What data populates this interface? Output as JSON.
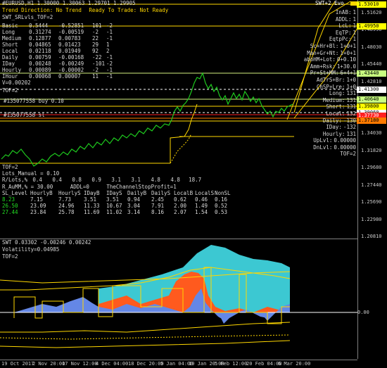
{
  "header": {
    "symbol_line": "#EURUSD,H1  1.30000 1.30063 1.29701 1.29905",
    "swt_top_right": "SWT+2 Evo",
    "trend_direction_label": "Trend Direction:",
    "trend_direction_value": "No Trend",
    "ready_label": "Ready To Trade:",
    "ready_value": "Not Ready",
    "indicator_line": "SWT_SRLvls_TOF=2"
  },
  "tf_table": {
    "rows": [
      {
        "name": "Basic",
        "a": "0.5444",
        "b": "-0.52851",
        "c": "101",
        "d": "-2"
      },
      {
        "name": "Long",
        "a": "0.31274",
        "b": "-0.00519",
        "c": "-2",
        "d": "-1"
      },
      {
        "name": "Medium",
        "a": "0.12877",
        "b": "0.00783",
        "c": "22",
        "d": "-1"
      },
      {
        "name": "Short",
        "a": "0.04865",
        "b": "0.01423",
        "c": "29",
        "d": "1"
      },
      {
        "name": "Local",
        "a": "0.02118",
        "b": "0.01949",
        "c": "92",
        "d": "2"
      },
      {
        "name": "Daily",
        "a": "0.00759",
        "b": "-0.00168",
        "c": "-22",
        "d": "-1"
      },
      {
        "name": "IDay",
        "a": "0.00248",
        "b": "-0.00249",
        "c": "-101",
        "d": "-2"
      },
      {
        "name": "Hourly",
        "a": "0.00089",
        "b": "-0.00002",
        "c": "-2",
        "d": "-1"
      },
      {
        "name": "IHour",
        "a": "0.00068",
        "b": "0.00007",
        "c": "11",
        "d": "-1"
      }
    ],
    "v_line": "V=0.00202",
    "tof_line": "TOF=2"
  },
  "right_info": {
    "rows": [
      {
        "label": "InAB:",
        "value": "1"
      },
      {
        "label": "ADDL:",
        "value": "1"
      },
      {
        "label": "LcL:",
        "value": "1"
      },
      {
        "label": "EqTP:",
        "value": "1"
      },
      {
        "label": "EqtpPc:",
        "value": "1"
      },
      {
        "label": "Sc+Hr+Bl:",
        "value": "1+0+1"
      },
      {
        "label": "Man+Gr+Nt:",
        "value": "1+0+1"
      },
      {
        "label": "aboHM+Lot:",
        "value": "0+0.10"
      },
      {
        "label": "Amm+Rsk:",
        "value": "1+30.0"
      },
      {
        "label": "Pr+St+MM:",
        "value": "6+4+1"
      },
      {
        "label": "AdTrS+Br:",
        "value": "1+0"
      },
      {
        "label": "ChSP+Lre:",
        "value": "1+0"
      },
      {
        "label": "Long:",
        "value": "131"
      },
      {
        "label": "Medium:",
        "value": "131"
      },
      {
        "label": "Short:",
        "value": "131"
      },
      {
        "label": "Local:",
        "value": "132"
      },
      {
        "label": "Daily:",
        "value": "-130"
      },
      {
        "label": "IDay:",
        "value": "-132"
      },
      {
        "label": "Hourly:",
        "value": "131"
      },
      {
        "label": "UpLvl:",
        "value": "0.00000"
      },
      {
        "label": "DnLvl:",
        "value": "0.00000"
      },
      {
        "label": "",
        "value": "TOF=2"
      }
    ]
  },
  "orders": {
    "buy": "#135077558 buy 0.10",
    "sl": "#135077558 sl"
  },
  "lots_panel": {
    "tof": "TOF=2",
    "lots_manual": "Lots_Manual = 0.10",
    "r_lots_label": "R/Lots,%",
    "r_lots_values": [
      "0.4",
      "0.4",
      "0.8",
      "0.9",
      "3.1",
      "3.1",
      "4.8",
      "4.8",
      "18.7"
    ],
    "r_aumm": "R_AuMM,% = 30.00",
    "addl": "ADDL=0",
    "stop_profit": "TheChannelStopProfit=1",
    "headers": [
      "SL_Level",
      "HourlyB",
      "HourlyS",
      "IDayB",
      "IDayS",
      "DailyB",
      "DailyS",
      "LocalB",
      "LocalS",
      "NonSL"
    ],
    "rows": [
      [
        "8.23",
        "7.15",
        "7.73",
        "3.51",
        "3.51",
        "0.94",
        "2.45",
        "0.62",
        "0.46",
        "0.16"
      ],
      [
        "26.50",
        "23.09",
        "24.96",
        "11.33",
        "10.67",
        "3.04",
        "7.91",
        "2.00",
        "1.49",
        "0.52"
      ],
      [
        "27.44",
        "23.84",
        "25.78",
        "11.69",
        "11.02",
        "3.14",
        "8.16",
        "2.07",
        "1.54",
        "0.53"
      ]
    ]
  },
  "sub_window": {
    "title": "SWT 0.03302 -0.00246 0.00242",
    "volatility": "Volatility=0.04985",
    "tof": "TOF=2",
    "zero_label": "0.00"
  },
  "price_labels": [
    {
      "value": "1.53010",
      "color": "#ffff00",
      "text_color": "#000000"
    },
    {
      "value": "1.49950",
      "color": "#ffff00",
      "text_color": "#000000"
    },
    {
      "value": "1.43440",
      "color": "#c8ff80",
      "text_color": "#000000"
    },
    {
      "value": "1.41300",
      "color": "#ffffff",
      "text_color": "#000000"
    },
    {
      "value": "1.40640",
      "color": "#c8ff80",
      "text_color": "#000000"
    },
    {
      "value": "1.39800",
      "color": "#ffff00",
      "text_color": "#000000"
    },
    {
      "value": "1.39060",
      "color": "#ffffff",
      "text_color": "#000000"
    },
    {
      "value": "1.37730",
      "color": "#ff2020",
      "text_color": "#ffffff"
    },
    {
      "value": "1.37180",
      "color": "#ff7a00",
      "text_color": "#000000"
    }
  ],
  "y_axis_ticks": [
    "1.51620",
    "1.48990",
    "1.48030",
    "1.45440",
    "1.42810",
    "1.38890",
    "1.36620",
    "1.34030",
    "1.31820",
    "1.29680",
    "1.27440",
    "1.25690",
    "1.22980",
    "1.20810"
  ],
  "x_axis_ticks": [
    "19 Oct 2017",
    "2 Nov 20:00",
    "17 Nov 12:00",
    "4 Dec 04:00",
    "18 Dec 20:00",
    "5 Jan 04:00",
    "19 Jan 20:00",
    "5 Feb 12:00",
    "20 Feb 04:00",
    "6 Mar 20:00"
  ],
  "colors": {
    "price_line": "#1ec81e",
    "level_yellow": "#ffd700",
    "cyan_area": "#3cc8d2",
    "orange_area": "#ff5a1e",
    "blue_area": "#6487e6",
    "sub_yellow": "#ffd700"
  }
}
